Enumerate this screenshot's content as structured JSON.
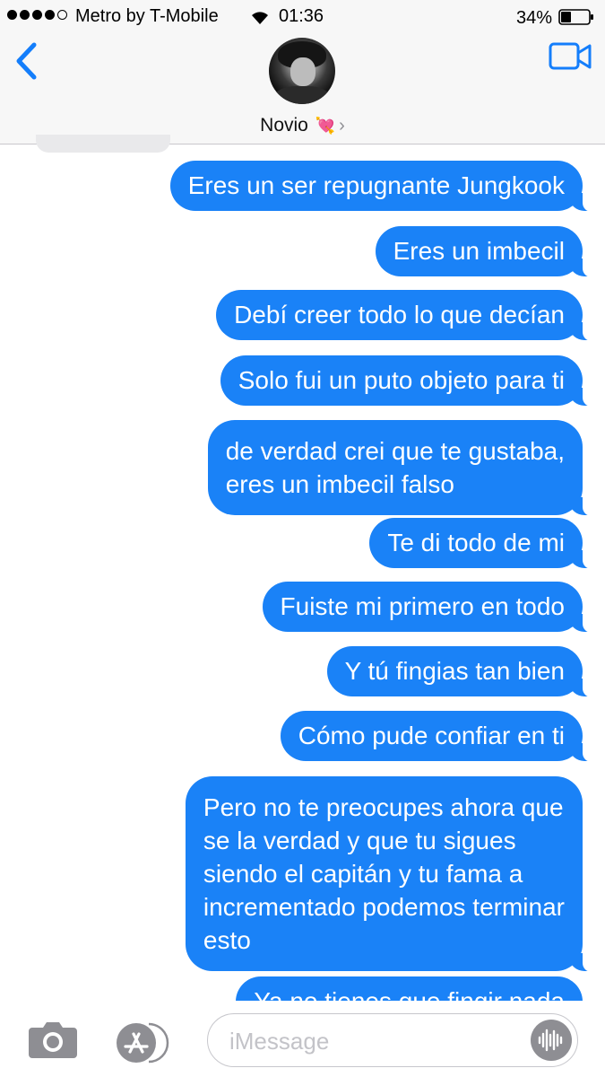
{
  "status_bar": {
    "carrier": "Metro by T-Mobile",
    "time": "01:36",
    "battery": "34%",
    "signal_bars_filled": 4,
    "signal_bars_total": 5
  },
  "header": {
    "contact_name": "Novio",
    "contact_emoji": "💘",
    "back_icon": "chevron-left-icon",
    "video_icon": "video-camera-icon"
  },
  "messages": [
    {
      "text": "Eres un ser repugnante Jungkook",
      "from": "me"
    },
    {
      "text": "Eres un imbecil",
      "from": "me"
    },
    {
      "text": "Debí creer todo lo que decían",
      "from": "me"
    },
    {
      "text": "Solo fui un puto objeto para ti",
      "from": "me"
    },
    {
      "lines": [
        "de verdad crei que te gustaba,",
        "eres un imbecil falso"
      ],
      "from": "me"
    },
    {
      "text": "Te di todo de mi",
      "from": "me"
    },
    {
      "text": "Fuiste mi primero en todo",
      "from": "me"
    },
    {
      "text": "Y tú fingias tan bien",
      "from": "me"
    },
    {
      "text": "Cómo pude confiar en ti",
      "from": "me"
    },
    {
      "lines": [
        "Pero no te preocupes ahora que",
        "se la verdad y que tu sigues",
        "siendo el capitán y tu fama a",
        "incrementado podemos terminar",
        "esto"
      ],
      "from": "me"
    },
    {
      "text": "Ya no tienes que fingir nada",
      "from": "me"
    }
  ],
  "input_bar": {
    "placeholder": "iMessage",
    "camera_icon": "camera-icon",
    "apps_icon": "app-store-icon",
    "audio_icon": "audio-waveform-icon"
  },
  "colors": {
    "bubble_blue": "#1a82f7",
    "ios_blue": "#147efb",
    "header_bg": "#f7f7f7"
  }
}
